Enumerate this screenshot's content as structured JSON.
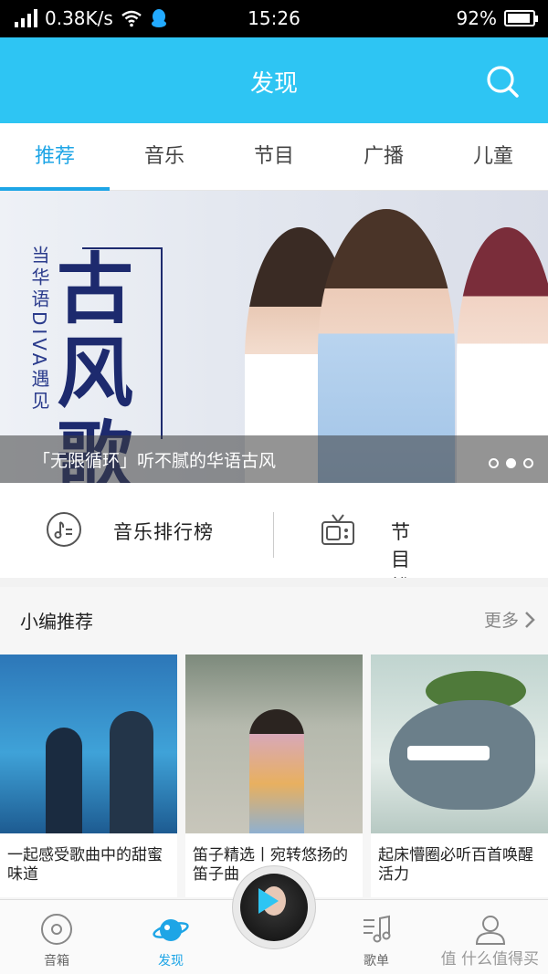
{
  "status": {
    "speed": "0.38K/s",
    "time": "15:26",
    "battery": "92%",
    "battery_level": 0.92
  },
  "header": {
    "title": "发现"
  },
  "tabs": [
    {
      "label": "推荐",
      "active": true
    },
    {
      "label": "音乐"
    },
    {
      "label": "节目"
    },
    {
      "label": "广播"
    },
    {
      "label": "儿童"
    }
  ],
  "banner": {
    "vertical_text": "当华语DIVA遇见",
    "big_title": "古风歌曲",
    "caption": "「无限循环」听不腻的华语古风",
    "dots": 3,
    "active_dot": 1
  },
  "charts": {
    "music_label": "音乐排行榜",
    "program_label": "节目排行榜"
  },
  "picks": {
    "title": "小编推荐",
    "more": "更多",
    "items": [
      {
        "text": "一起感受歌曲中的甜蜜味道"
      },
      {
        "text": "笛子精选丨宛转悠扬的笛子曲"
      },
      {
        "text": "起床懵圈必听百首唤醒活力"
      }
    ]
  },
  "nav": {
    "items": [
      {
        "label": "音箱"
      },
      {
        "label": "发现"
      },
      {
        "label": "歌单"
      },
      {
        "label": ""
      }
    ],
    "watermark": "值 什么值得买"
  },
  "colors": {
    "accent": "#2ec5f3",
    "active": "#1ea5e6"
  }
}
